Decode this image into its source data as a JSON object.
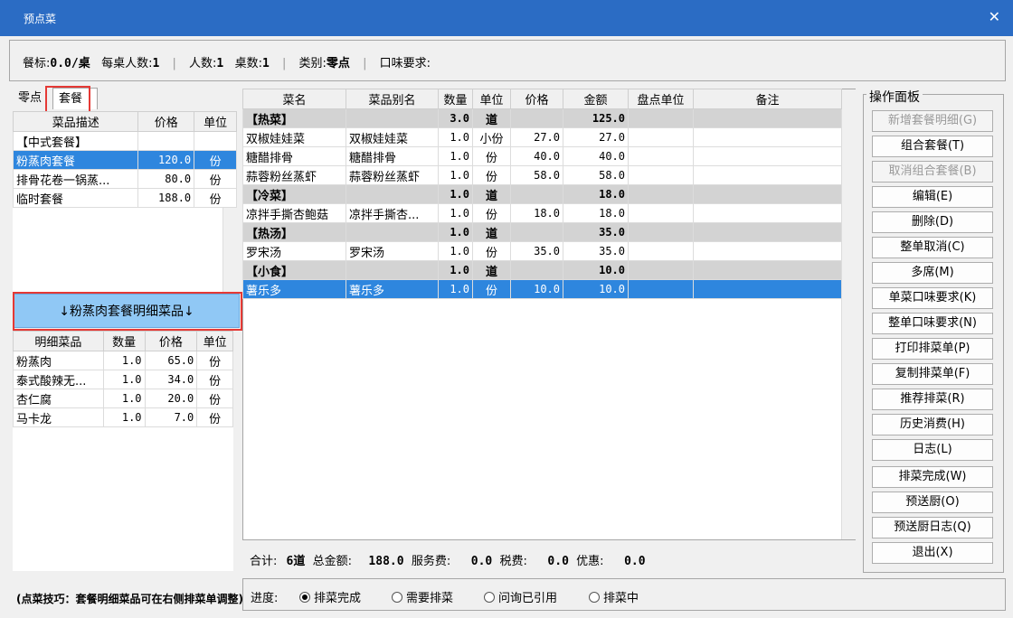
{
  "window": {
    "title": "预点菜",
    "close": "✕"
  },
  "info": {
    "canbiao_label": "餐标:",
    "canbiao_value": "0.0/桌",
    "perTable_label": "每桌人数:",
    "perTable_value": "1",
    "people_label": "人数:",
    "people_value": "1",
    "tables_label": "桌数:",
    "tables_value": "1",
    "category_label": "类别:",
    "category_value": "零点",
    "taste_label": "口味要求:",
    "separator": "|"
  },
  "left": {
    "tabs": [
      "零点",
      "套餐"
    ],
    "setmeal_headers": [
      "菜品描述",
      "价格",
      "单位"
    ],
    "setmeals": [
      {
        "name": "【中式套餐】",
        "price": "",
        "unit": ""
      },
      {
        "name": "粉蒸肉套餐",
        "price": "120.0",
        "unit": "份"
      },
      {
        "name": "排骨花卷一锅蒸...",
        "price": "80.0",
        "unit": "份"
      },
      {
        "name": "临时套餐",
        "price": "188.0",
        "unit": "份"
      }
    ],
    "detail_button": "↓粉蒸肉套餐明细菜品↓",
    "detail_headers": [
      "明细菜品",
      "数量",
      "价格",
      "单位"
    ],
    "details": [
      {
        "name": "粉蒸肉",
        "qty": "1.0",
        "price": "65.0",
        "unit": "份"
      },
      {
        "name": "泰式酸辣无...",
        "qty": "1.0",
        "price": "34.0",
        "unit": "份"
      },
      {
        "name": "杏仁腐",
        "qty": "1.0",
        "price": "20.0",
        "unit": "份"
      },
      {
        "name": "马卡龙",
        "qty": "1.0",
        "price": "7.0",
        "unit": "份"
      }
    ],
    "tip": "(点菜技巧：套餐明细菜品可在右侧排菜单调整)"
  },
  "dishes": {
    "headers": [
      "菜名",
      "菜品别名",
      "数量",
      "单位",
      "价格",
      "金额",
      "盘点单位",
      "备注"
    ],
    "rows": [
      {
        "group": true,
        "name": "【热菜】",
        "alias": "",
        "qty": "3.0",
        "unit": "道",
        "price": "",
        "amount": "125.0"
      },
      {
        "name": "双椒娃娃菜",
        "alias": "双椒娃娃菜",
        "qty": "1.0",
        "unit": "小份",
        "price": "27.0",
        "amount": "27.0"
      },
      {
        "name": "糖醋排骨",
        "alias": "糖醋排骨",
        "qty": "1.0",
        "unit": "份",
        "price": "40.0",
        "amount": "40.0"
      },
      {
        "name": "蒜蓉粉丝蒸虾",
        "alias": "蒜蓉粉丝蒸虾",
        "qty": "1.0",
        "unit": "份",
        "price": "58.0",
        "amount": "58.0"
      },
      {
        "group": true,
        "name": "【冷菜】",
        "alias": "",
        "qty": "1.0",
        "unit": "道",
        "price": "",
        "amount": "18.0"
      },
      {
        "name": "凉拌手撕杏鲍菇",
        "alias": "凉拌手撕杏...",
        "qty": "1.0",
        "unit": "份",
        "price": "18.0",
        "amount": "18.0"
      },
      {
        "group": true,
        "name": "【热汤】",
        "alias": "",
        "qty": "1.0",
        "unit": "道",
        "price": "",
        "amount": "35.0"
      },
      {
        "name": "罗宋汤",
        "alias": "罗宋汤",
        "qty": "1.0",
        "unit": "份",
        "price": "35.0",
        "amount": "35.0"
      },
      {
        "group": true,
        "name": "【小食】",
        "alias": "",
        "qty": "1.0",
        "unit": "道",
        "price": "",
        "amount": "10.0"
      },
      {
        "selected": true,
        "name": "薯乐多",
        "alias": "薯乐多",
        "qty": "1.0",
        "unit": "份",
        "price": "10.0",
        "amount": "10.0"
      }
    ]
  },
  "summary": {
    "total_label": "合计:",
    "total_value": "6道",
    "amount_label": "总金额:",
    "amount_value": "188.0",
    "service_label": "服务费:",
    "service_value": "0.0",
    "tax_label": "税费:",
    "tax_value": "0.0",
    "discount_label": "优惠:",
    "discount_value": "0.0"
  },
  "progress": {
    "label": "进度:",
    "options": [
      "排菜完成",
      "需要排菜",
      "问询已引用",
      "排菜中"
    ],
    "selected_index": 0
  },
  "ops": {
    "title": "操作面板",
    "buttons": [
      {
        "label": "新增套餐明细(G)",
        "disabled": true
      },
      {
        "label": "组合套餐(T)",
        "disabled": false
      },
      {
        "label": "取消组合套餐(B)",
        "disabled": true
      },
      {
        "label": "编辑(E)",
        "disabled": false
      },
      {
        "label": "删除(D)",
        "disabled": false
      },
      {
        "label": "整单取消(C)",
        "disabled": false
      },
      {
        "label": "多席(M)",
        "disabled": false
      },
      {
        "label": "单菜口味要求(K)",
        "disabled": false
      },
      {
        "label": "整单口味要求(N)",
        "disabled": false
      },
      {
        "label": "打印排菜单(P)",
        "disabled": false
      },
      {
        "label": "复制排菜单(F)",
        "disabled": false
      },
      {
        "label": "推荐排菜(R)",
        "disabled": false
      },
      {
        "label": "历史消费(H)",
        "disabled": false
      },
      {
        "label": "日志(L)",
        "disabled": false
      },
      {
        "label": "排菜完成(W)",
        "disabled": false
      },
      {
        "label": "预送厨(O)",
        "disabled": false
      },
      {
        "label": "预送厨日志(Q)",
        "disabled": false
      },
      {
        "label": "退出(X)",
        "disabled": false
      }
    ]
  },
  "colors": {
    "titlebar": "#2b6cc4",
    "selection": "#2e86de",
    "detail_button": "#90c8f5",
    "highlight_box": "#e53935"
  }
}
